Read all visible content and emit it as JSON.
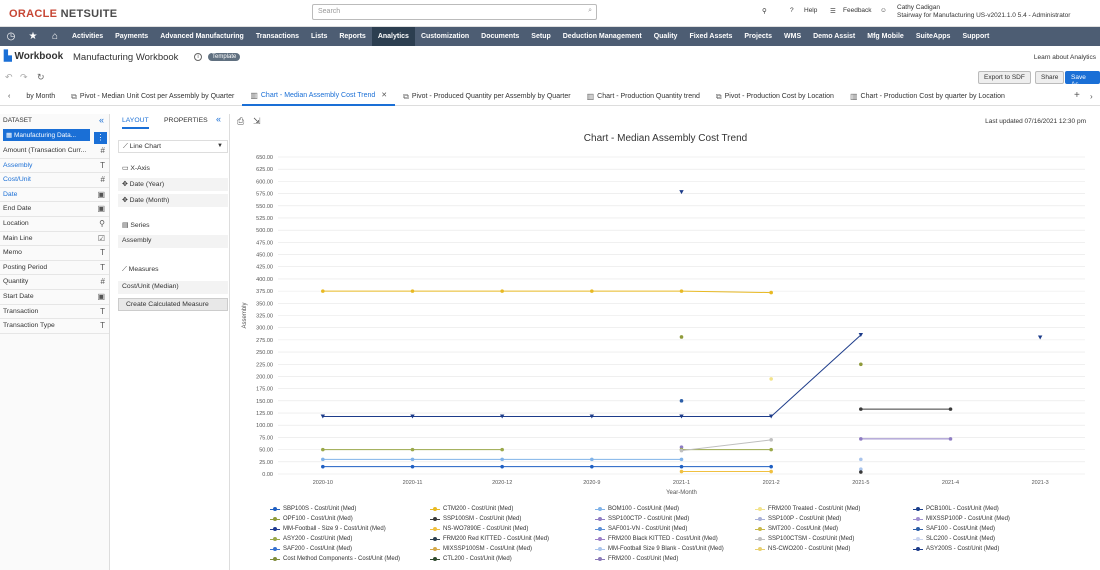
{
  "brand": {
    "part1": "ORACLE",
    "part2": " NETSUITE"
  },
  "search": {
    "placeholder": "Search"
  },
  "topright": {
    "help": "Help",
    "feedback": "Feedback",
    "user_name": "Cathy Cadigan",
    "user_role": "Stairway for Manufacturing US-v2021.1.0 5.4 - Administrator"
  },
  "nav": [
    "Activities",
    "Payments",
    "Advanced Manufacturing",
    "Transactions",
    "Lists",
    "Reports",
    "Analytics",
    "Customization",
    "Documents",
    "Setup",
    "Deduction Management",
    "Quality",
    "Fixed Assets",
    "Projects",
    "WMS",
    "Demo Assist",
    "Mfg Mobile",
    "SuiteApps",
    "Support"
  ],
  "nav_active": "Analytics",
  "page": {
    "title": "Workbook",
    "subtitle": "Manufacturing Workbook",
    "badge": "Template",
    "learn": "Learn about Analytics"
  },
  "actions": {
    "export": "Export to SDF",
    "share": "Share",
    "save_as": "Save As"
  },
  "tabs": [
    {
      "label": "by Month",
      "active": false,
      "icon": ""
    },
    {
      "label": "Pivot - Median Unit Cost per Assembly by Quarter",
      "active": false,
      "icon": "pivot-icon"
    },
    {
      "label": "Chart - Median Assembly Cost Trend",
      "active": true,
      "icon": "chart-icon"
    },
    {
      "label": "Pivot - Produced Quantity per Assembly by Quarter",
      "active": false,
      "icon": "pivot-icon"
    },
    {
      "label": "Chart - Production Quantity trend",
      "active": false,
      "icon": "chart-icon"
    },
    {
      "label": "Pivot - Production Cost by Location",
      "active": false,
      "icon": "pivot-icon"
    },
    {
      "label": "Chart - Production Cost by quarter by Location",
      "active": false,
      "icon": "chart-icon"
    }
  ],
  "dataset": {
    "header": "DATASET",
    "selected": "Manufacturing Data...",
    "fields": [
      {
        "label": "Amount (Transaction Curr...",
        "type": "#",
        "blue": false
      },
      {
        "label": "Assembly",
        "type": "T",
        "blue": true
      },
      {
        "label": "Cost/Unit",
        "type": "#",
        "blue": true
      },
      {
        "label": "Date",
        "type": "cal",
        "blue": true
      },
      {
        "label": "End Date",
        "type": "cal",
        "blue": false
      },
      {
        "label": "Location",
        "type": "tree",
        "blue": false
      },
      {
        "label": "Main Line",
        "type": "bool",
        "blue": false
      },
      {
        "label": "Memo",
        "type": "T",
        "blue": false
      },
      {
        "label": "Posting Period",
        "type": "T",
        "blue": false
      },
      {
        "label": "Quantity",
        "type": "#",
        "blue": false
      },
      {
        "label": "Start Date",
        "type": "cal",
        "blue": false
      },
      {
        "label": "Transaction",
        "type": "T",
        "blue": false
      },
      {
        "label": "Transaction Type",
        "type": "T",
        "blue": false
      }
    ]
  },
  "layout_panel": {
    "tab_layout": "LAYOUT",
    "tab_properties": "PROPERTIES",
    "chart_type": "Line Chart",
    "xaxis_label": "X-Axis",
    "xaxis_items": [
      "Date (Year)",
      "Date (Month)"
    ],
    "series_label": "Series",
    "series_item": "Assembly",
    "measures_label": "Measures",
    "measures_item": "Cost/Unit (Median)",
    "calc_button": "Create Calculated Measure"
  },
  "last_updated": "Last updated 07/16/2021 12:30 pm",
  "chart_data": {
    "type": "line",
    "title": "Chart - Median Assembly Cost Trend",
    "xlabel": "Year-Month",
    "ylabel": "Assembly",
    "ylim": [
      0,
      650
    ],
    "yticks": [
      "0.00",
      "25.00",
      "50.00",
      "75.00",
      "100.00",
      "125.00",
      "150.00",
      "175.00",
      "200.00",
      "225.00",
      "250.00",
      "275.00",
      "300.00",
      "325.00",
      "350.00",
      "375.00",
      "400.00",
      "425.00",
      "450.00",
      "475.00",
      "500.00",
      "525.00",
      "550.00",
      "575.00",
      "600.00",
      "625.00",
      "650.00"
    ],
    "categories": [
      "2020-10",
      "2020-11",
      "2020-12",
      "2020-9",
      "2021-1",
      "2021-2",
      "2021-5",
      "2021-4",
      "2021-3"
    ],
    "grid": true,
    "legend_position": "bottom",
    "series": [
      {
        "name": "SBP100S - Cost/Unit (Med)",
        "color": "#1f5fc2",
        "marker": "circle",
        "values": [
          15,
          15,
          15,
          15,
          15,
          15,
          null,
          null,
          null
        ]
      },
      {
        "name": "CTM200 - Cost/Unit (Med)",
        "color": "#e8b923",
        "marker": "circle",
        "values": [
          375,
          375,
          375,
          375,
          375,
          372,
          null,
          null,
          null
        ]
      },
      {
        "name": "BOM100 - Cost/Unit (Med)",
        "color": "#7fb2e8",
        "marker": "circle",
        "values": [
          30,
          30,
          30,
          30,
          30,
          null,
          null,
          null,
          null
        ]
      },
      {
        "name": "FRM200 Treated - Cost/Unit (Med)",
        "color": "#f2e38c",
        "marker": "circle",
        "values": [
          null,
          null,
          null,
          null,
          null,
          195,
          null,
          null,
          null
        ]
      },
      {
        "name": "PCB100L - Cost/Unit (Med)",
        "color": "#1a3e8c",
        "marker": "circle",
        "values": [
          null,
          null,
          null,
          null,
          null,
          null,
          null,
          null,
          null
        ]
      },
      {
        "name": "OPF100 - Cost/Unit (Med)",
        "color": "#8f9a3a",
        "marker": "circle",
        "values": [
          null,
          null,
          null,
          null,
          281,
          null,
          225,
          null,
          null
        ]
      },
      {
        "name": "SSP100SM - Cost/Unit (Med)",
        "color": "#3a3a3a",
        "marker": "circle",
        "values": [
          null,
          null,
          null,
          null,
          null,
          null,
          133,
          133,
          null
        ]
      },
      {
        "name": "SSP100CTP - Cost/Unit (Med)",
        "color": "#8e7cc3",
        "marker": "circle",
        "values": [
          null,
          null,
          null,
          null,
          55,
          null,
          72,
          72,
          null
        ]
      },
      {
        "name": "SSP100P - Cost/Unit (Med)",
        "color": "#a8b0d8",
        "marker": "circle",
        "values": [
          null,
          null,
          null,
          null,
          null,
          null,
          null,
          null,
          null
        ]
      },
      {
        "name": "MIXSSP100P - Cost/Unit (Med)",
        "color": "#9e8fd0",
        "marker": "circle",
        "values": [
          null,
          null,
          null,
          null,
          null,
          null,
          null,
          null,
          null
        ]
      },
      {
        "name": "MM-Football - Size 9 - Cost/Unit (Med)",
        "color": "#1f3a93",
        "marker": "circle",
        "values": [
          null,
          null,
          null,
          null,
          null,
          null,
          null,
          null,
          null
        ]
      },
      {
        "name": "NS-WO7890E - Cost/Unit (Med)",
        "color": "#f0c040",
        "marker": "circle",
        "values": [
          null,
          null,
          null,
          null,
          5,
          5,
          null,
          null,
          null
        ]
      },
      {
        "name": "SAF001-VN - Cost/Unit (Med)",
        "color": "#5b8fd6",
        "marker": "circle",
        "values": [
          null,
          null,
          null,
          null,
          null,
          null,
          null,
          null,
          null
        ]
      },
      {
        "name": "SMT200 - Cost/Unit (Med)",
        "color": "#c8b84a",
        "marker": "circle",
        "values": [
          null,
          null,
          null,
          null,
          null,
          null,
          null,
          null,
          null
        ]
      },
      {
        "name": "SAF100 - Cost/Unit (Med)",
        "color": "#2d5fa8",
        "marker": "circle",
        "values": [
          null,
          null,
          null,
          null,
          150,
          null,
          null,
          null,
          null
        ]
      },
      {
        "name": "ASY200 - Cost/Unit (Med)",
        "color": "#9aa84a",
        "marker": "circle",
        "values": [
          50,
          50,
          50,
          null,
          50,
          50,
          null,
          null,
          null
        ]
      },
      {
        "name": "FRM200 Red KITTED - Cost/Unit (Med)",
        "color": "#2c3e50",
        "marker": "circle",
        "values": [
          null,
          null,
          null,
          null,
          null,
          null,
          null,
          null,
          null
        ]
      },
      {
        "name": "FRM200 Black KITTED - Cost/Unit (Med)",
        "color": "#9b7fc8",
        "marker": "circle",
        "values": [
          null,
          null,
          null,
          null,
          null,
          null,
          null,
          null,
          null
        ]
      },
      {
        "name": "SSP100CTSM - Cost/Unit (Med)",
        "color": "#bfbfbf",
        "marker": "circle",
        "values": [
          null,
          null,
          null,
          null,
          48,
          70,
          null,
          null,
          null
        ]
      },
      {
        "name": "SLC200 - Cost/Unit (Med)",
        "color": "#c9d4f0",
        "marker": "circle",
        "values": [
          null,
          null,
          null,
          null,
          null,
          null,
          null,
          null,
          null
        ]
      },
      {
        "name": "SAF200 - Cost/Unit (Med)",
        "color": "#3670d0",
        "marker": "circle",
        "values": [
          null,
          null,
          null,
          null,
          null,
          null,
          null,
          null,
          null
        ]
      },
      {
        "name": "MIXSSP100SM - Cost/Unit (Med)",
        "color": "#d4a84a",
        "marker": "circle",
        "values": [
          null,
          null,
          null,
          null,
          null,
          null,
          null,
          null,
          null
        ]
      },
      {
        "name": "MM-Football Size 9 Blank - Cost/Unit (Med)",
        "color": "#a9c4ec",
        "marker": "circle",
        "values": [
          null,
          null,
          null,
          null,
          null,
          null,
          10,
          null,
          null
        ]
      },
      {
        "name": "NS-CWO200 - Cost/Unit (Med)",
        "color": "#e8d070",
        "marker": "circle",
        "values": [
          null,
          null,
          null,
          null,
          null,
          null,
          null,
          null,
          null
        ]
      },
      {
        "name": "ASY200S - Cost/Unit (Med)",
        "color": "#1d3c8a",
        "marker": "triangle",
        "values": [
          118,
          118,
          118,
          118,
          118,
          118,
          285,
          null,
          280
        ]
      },
      {
        "name": "Cost Method Components - Cost/Unit (Med)",
        "color": "#7f8c3a",
        "marker": "circle",
        "values": [
          null,
          null,
          null,
          null,
          null,
          null,
          null,
          null,
          null
        ]
      },
      {
        "name": "CTL200 - Cost/Unit (Med)",
        "color": "#2e4a2e",
        "marker": "circle",
        "values": [
          null,
          null,
          null,
          null,
          null,
          null,
          null,
          null,
          null
        ]
      },
      {
        "name": "FRM200 - Cost/Unit (Med)",
        "color": "#8a7ab8",
        "marker": "circle",
        "values": [
          null,
          null,
          null,
          null,
          null,
          null,
          null,
          null,
          null
        ]
      }
    ],
    "extra_points": [
      {
        "series": "ASY200S - Cost/Unit (Med)",
        "x": "2021-1",
        "y": 578
      },
      {
        "series": "MM-Football Size 9 Blank - Cost/Unit (Med)",
        "x": "2021-5",
        "y": 30
      },
      {
        "series": "SSP100SM - Cost/Unit (Med)",
        "x": "2021-5",
        "y": 4
      }
    ]
  }
}
